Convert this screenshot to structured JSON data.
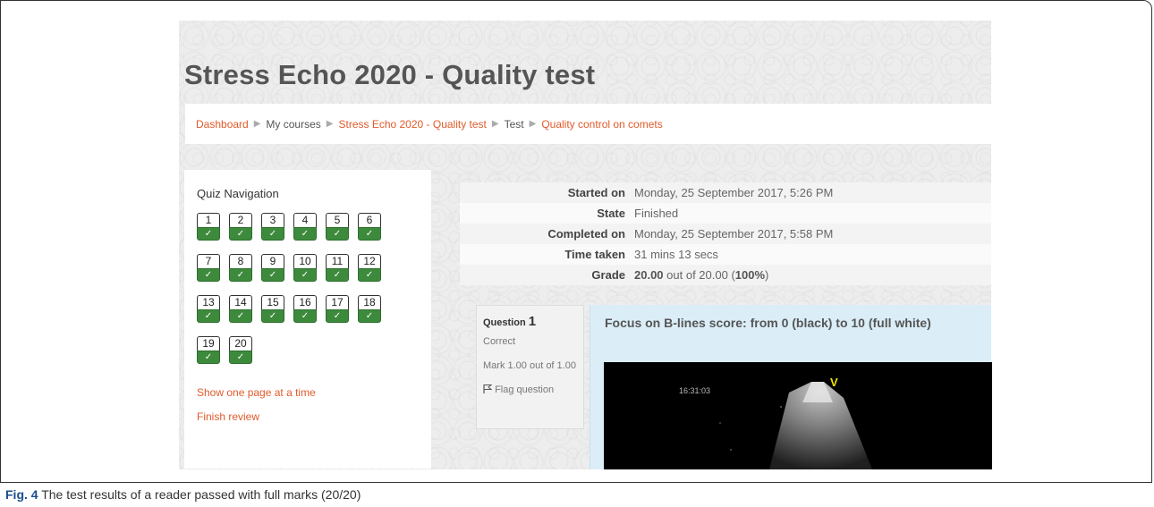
{
  "page_title": "Stress Echo 2020 - Quality test",
  "breadcrumb": [
    {
      "label": "Dashboard",
      "link": true
    },
    {
      "label": "My courses",
      "link": false
    },
    {
      "label": "Stress Echo 2020 - Quality test",
      "link": true
    },
    {
      "label": "Test",
      "link": false
    },
    {
      "label": "Quality control on comets",
      "link": true
    }
  ],
  "quiz_nav": {
    "title": "Quiz Navigation",
    "questions": [
      "1",
      "2",
      "3",
      "4",
      "5",
      "6",
      "7",
      "8",
      "9",
      "10",
      "11",
      "12",
      "13",
      "14",
      "15",
      "16",
      "17",
      "18",
      "19",
      "20"
    ],
    "status_glyph": "✓",
    "show_one_page": "Show one page at a time",
    "finish_review": "Finish review"
  },
  "summary": [
    {
      "label": "Started on",
      "value": "Monday, 25 September 2017, 5:26 PM"
    },
    {
      "label": "State",
      "value": "Finished"
    },
    {
      "label": "Completed on",
      "value": "Monday, 25 September 2017, 5:58 PM"
    },
    {
      "label": "Time taken",
      "value": "31 mins 13 secs"
    }
  ],
  "grade": {
    "label": "Grade",
    "score": "20.00",
    "mid": " out of 20.00 (",
    "percent": "100%",
    "end": ")"
  },
  "question": {
    "prefix": "Question",
    "number": "1",
    "status": "Correct",
    "mark": "Mark 1.00 out of 1.00",
    "flag": "Flag question",
    "text": "Focus on B-lines score: from 0 (black) to  10 (full white)",
    "image_timestamp": "16:31:03",
    "image_marker": "V"
  },
  "caption": {
    "label": "Fig. 4",
    "text": " The test results of a reader passed with full marks (20/20)"
  },
  "colors": {
    "link": "#e05a2a",
    "correct_green": "#3d8a3d",
    "question_bg": "#dbeef8",
    "caption_label": "#1a4f8e"
  }
}
